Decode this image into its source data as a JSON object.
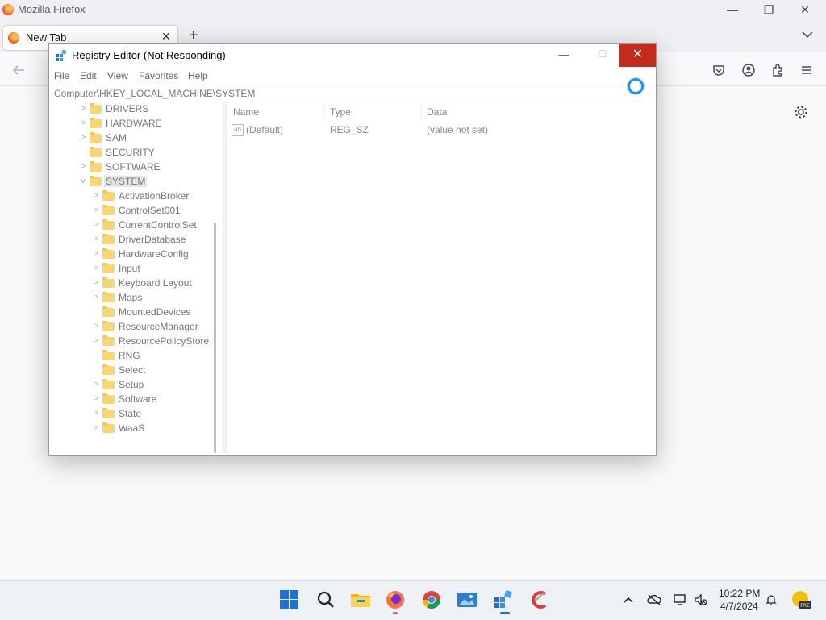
{
  "firefox": {
    "window_title": "Mozilla Firefox",
    "tab_title": "New Tab",
    "tab_close": "✕",
    "new_tab": "+",
    "minimize": "—",
    "restore": "❐",
    "close": "✕",
    "tabs_list": "⌄",
    "toolbar_icons": [
      "back-arrow-icon",
      "pocket-icon",
      "account-icon",
      "extensions-icon",
      "menu-icon"
    ],
    "settings_icon": "gear-icon"
  },
  "regedit": {
    "title": "Registry Editor (Not Responding)",
    "minimize": "—",
    "maximize": "☐",
    "close": "✕",
    "menu": [
      "File",
      "Edit",
      "View",
      "Favorites",
      "Help"
    ],
    "address": "Computer\\HKEY_LOCAL_MACHINE\\SYSTEM",
    "tree": [
      {
        "label": "DRIVERS",
        "expander": ">"
      },
      {
        "label": "HARDWARE",
        "expander": ">"
      },
      {
        "label": "SAM",
        "expander": ">"
      },
      {
        "label": "SECURITY",
        "expander": ""
      },
      {
        "label": "SOFTWARE",
        "expander": ">"
      },
      {
        "label": "SYSTEM",
        "expander": "v",
        "selected": true
      },
      {
        "label": "ActivationBroker",
        "expander": ">",
        "child": true
      },
      {
        "label": "ControlSet001",
        "expander": ">",
        "child": true
      },
      {
        "label": "CurrentControlSet",
        "expander": ">",
        "child": true
      },
      {
        "label": "DriverDatabase",
        "expander": ">",
        "child": true
      },
      {
        "label": "HardwareConfig",
        "expander": ">",
        "child": true
      },
      {
        "label": "Input",
        "expander": ">",
        "child": true
      },
      {
        "label": "Keyboard Layout",
        "expander": ">",
        "child": true
      },
      {
        "label": "Maps",
        "expander": ">",
        "child": true
      },
      {
        "label": "MountedDevices",
        "expander": "",
        "child": true
      },
      {
        "label": "ResourceManager",
        "expander": ">",
        "child": true
      },
      {
        "label": "ResourcePolicyStore",
        "expander": ">",
        "child": true
      },
      {
        "label": "RNG",
        "expander": "",
        "child": true
      },
      {
        "label": "Select",
        "expander": "",
        "child": true
      },
      {
        "label": "Setup",
        "expander": ">",
        "child": true
      },
      {
        "label": "Software",
        "expander": ">",
        "child": true
      },
      {
        "label": "State",
        "expander": ">",
        "child": true
      },
      {
        "label": "WaaS",
        "expander": ">",
        "child": true
      }
    ],
    "columns": {
      "name": "Name",
      "type": "Type",
      "data": "Data"
    },
    "values": [
      {
        "icon": "ab",
        "name": "(Default)",
        "type": "REG_SZ",
        "data": "(value not set)"
      }
    ]
  },
  "taskbar": {
    "apps": [
      "start-icon",
      "search-icon",
      "file-explorer-icon",
      "firefox-icon",
      "chrome-icon",
      "photos-icon",
      "regedit-icon",
      "ccleaner-icon"
    ],
    "tray": {
      "overflow": "^",
      "time": "10:22 PM",
      "date": "4/7/2024"
    }
  },
  "colors": {
    "regedit_close": "#c42b1c",
    "spinner": "#1e90ff",
    "folder": "#f7d774",
    "start": "#1a73d9"
  }
}
